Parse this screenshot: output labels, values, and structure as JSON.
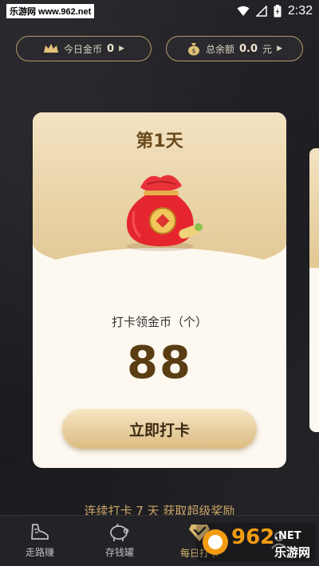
{
  "status_bar": {
    "watermark_label": "乐游网 www.962.net",
    "time": "2:32"
  },
  "pills": {
    "today_coins_label": "今日金币",
    "today_coins_value": "0",
    "balance_label": "总余额",
    "balance_value": "0.0",
    "balance_unit": "元"
  },
  "card": {
    "day_title": "第1天",
    "label": "打卡领金币（个）",
    "coin_count": "88",
    "checkin_button": "立即打卡"
  },
  "streak_text": "连续打卡 7 天 获取超级奖励",
  "nav": {
    "items": [
      {
        "label": "走路赚",
        "icon": "shoe-icon"
      },
      {
        "label": "存钱罐",
        "icon": "piggy-bank-icon"
      },
      {
        "label": "每日打卡",
        "icon": "diamond-checkin-icon"
      },
      {
        "label": "",
        "icon": "profile-icon"
      }
    ]
  },
  "logo_watermark": {
    "number": "962",
    "text": "乐游网"
  },
  "colors": {
    "accent_gold": "#d9b872",
    "dark_brown": "#5a3d12",
    "background": "#1e1e22"
  }
}
